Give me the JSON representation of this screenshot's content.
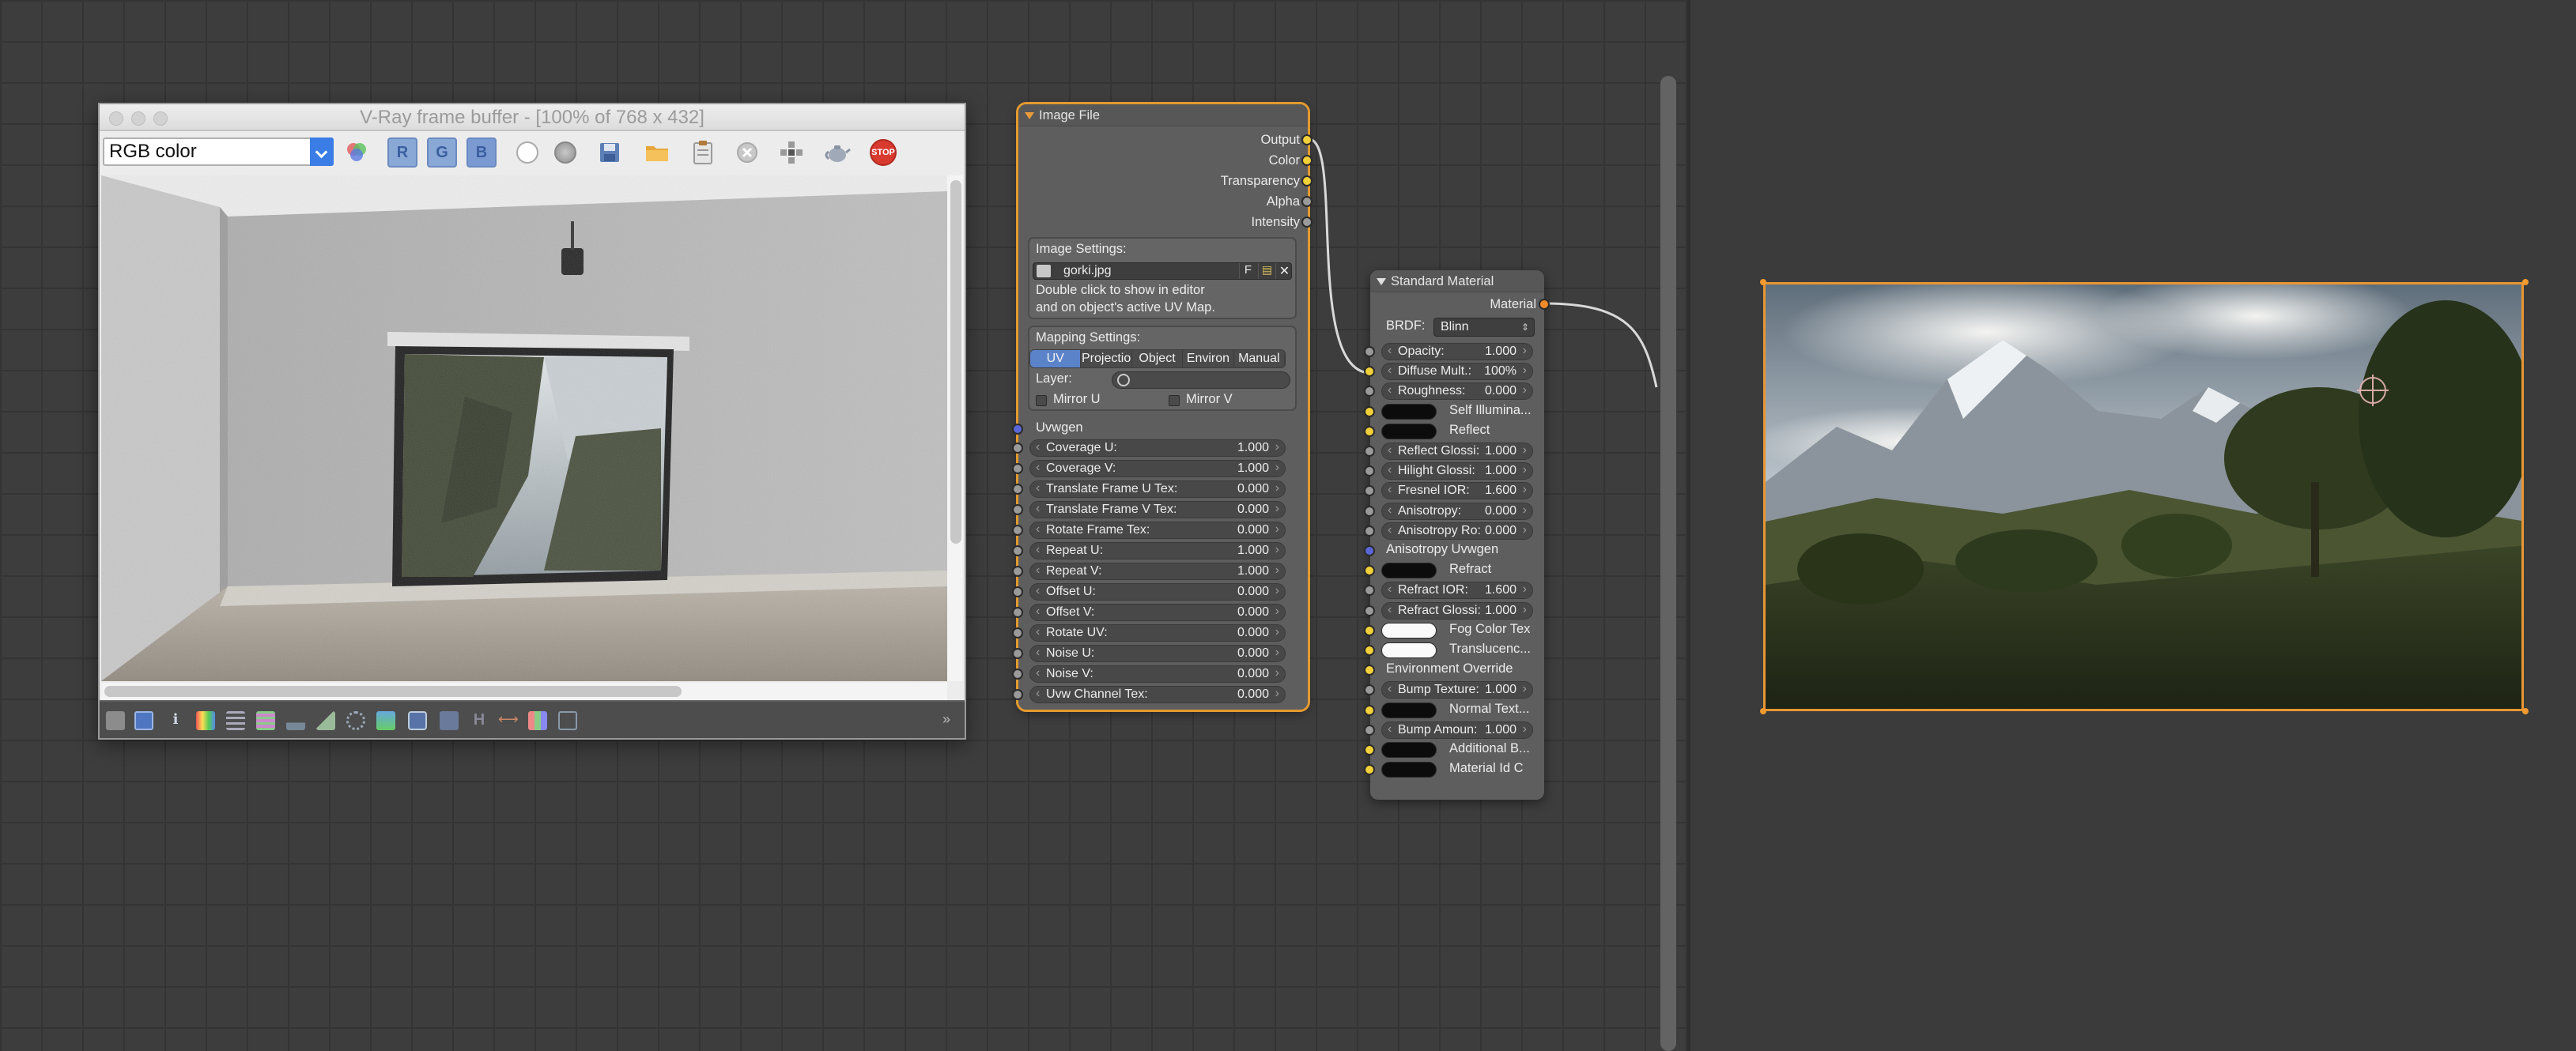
{
  "vfb": {
    "title": "V-Ray frame buffer - [100% of 768 x 432]",
    "channel": "RGB color",
    "channel_buttons": [
      "R",
      "G",
      "B"
    ],
    "stop_label": "STOP"
  },
  "image_node": {
    "title": "Image File",
    "outputs": [
      "Output",
      "Color",
      "Transparency",
      "Alpha",
      "Intensity"
    ],
    "image_settings_label": "Image Settings:",
    "filename": "gorki.jpg",
    "f_label": "F",
    "hint_line1": "Double click to show in editor",
    "hint_line2": "and on object's active UV Map.",
    "mapping_label": "Mapping Settings:",
    "mapping_tabs": [
      "UV",
      "Projectio",
      "Object",
      "Environ",
      "Manual"
    ],
    "layer_label": "Layer:",
    "mirror_u": "Mirror U",
    "mirror_v": "Mirror V",
    "uvwgen_label": "Uvwgen",
    "params": [
      {
        "label": "Coverage U:",
        "value": "1.000"
      },
      {
        "label": "Coverage V:",
        "value": "1.000"
      },
      {
        "label": "Translate Frame U Tex:",
        "value": "0.000"
      },
      {
        "label": "Translate Frame V Tex:",
        "value": "0.000"
      },
      {
        "label": "Rotate Frame Tex:",
        "value": "0.000"
      },
      {
        "label": "Repeat U:",
        "value": "1.000"
      },
      {
        "label": "Repeat V:",
        "value": "1.000"
      },
      {
        "label": "Offset U:",
        "value": "0.000"
      },
      {
        "label": "Offset V:",
        "value": "0.000"
      },
      {
        "label": "Rotate UV:",
        "value": "0.000"
      },
      {
        "label": "Noise U:",
        "value": "0.000"
      },
      {
        "label": "Noise V:",
        "value": "0.000"
      },
      {
        "label": "Uvw Channel Tex:",
        "value": "0.000"
      }
    ]
  },
  "material_node": {
    "title": "Standard Material",
    "output": "Material",
    "brdf_label": "BRDF:",
    "brdf_value": "Blinn",
    "opacity": {
      "label": "Opacity:",
      "value": "1.000"
    },
    "diffuse_mult": {
      "label": "Diffuse Mult.:",
      "value": "100%"
    },
    "roughness": {
      "label": "Roughness:",
      "value": "0.000"
    },
    "self_illum": "Self Illumina...",
    "reflect": "Reflect",
    "reflect_gloss": {
      "label": "Reflect Glossi:",
      "value": "1.000"
    },
    "hilight_gloss": {
      "label": "Hilight Glossi:",
      "value": "1.000"
    },
    "fresnel_ior": {
      "label": "Fresnel IOR:",
      "value": "1.600"
    },
    "anisotropy": {
      "label": "Anisotropy:",
      "value": "0.000"
    },
    "anisotropy_rot": {
      "label": "Anisotropy Ro:",
      "value": "0.000"
    },
    "anisotropy_uvwgen": "Anisotropy Uvwgen",
    "refract": "Refract",
    "refract_ior": {
      "label": "Refract IOR:",
      "value": "1.600"
    },
    "refract_gloss": {
      "label": "Refract Glossi:",
      "value": "1.000"
    },
    "fog_color": "Fog Color Tex",
    "translucency": "Translucenc...",
    "env_override": "Environment Override",
    "bump_texture": {
      "label": "Bump Texture:",
      "value": "1.000"
    },
    "normal_text": "Normal Text...",
    "bump_amount": {
      "label": "Bump Amoun:",
      "value": "1.000"
    },
    "additional": "Additional B...",
    "material_id": "Material Id C"
  },
  "colors": {
    "selection": "#e89633",
    "socket_yellow": "#f1d03a",
    "socket_blue": "#5a67d8",
    "active_tab": "#5b83c9"
  }
}
